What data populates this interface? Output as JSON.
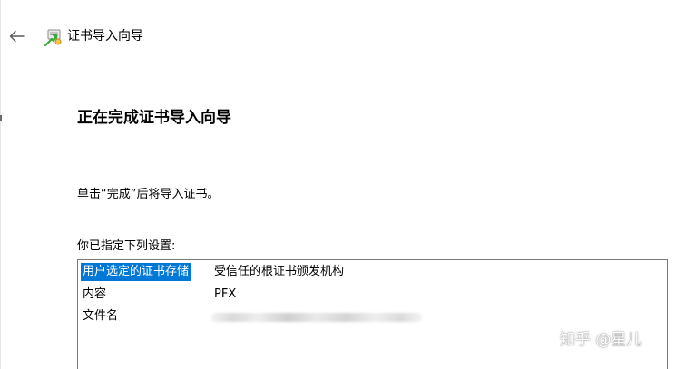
{
  "window": {
    "title": "证书导入向导",
    "back_icon": "arrow-left-icon",
    "wizard_icon": "certificate-import-icon"
  },
  "page": {
    "heading": "正在完成证书导入向导",
    "instruction": "单击“完成”后将导入证书。",
    "settings_label": "你已指定下列设置:"
  },
  "settings": {
    "rows": [
      {
        "key": "用户选定的证书存储",
        "value": "受信任的根证书颁发机构",
        "selected": true
      },
      {
        "key": "内容",
        "value": "PFX",
        "selected": false
      },
      {
        "key": "文件名",
        "value": "",
        "redacted": true,
        "selected": false
      }
    ]
  },
  "colors": {
    "selection": "#0078d7",
    "border": "#7a7a7a"
  },
  "watermark": {
    "text": "知乎 @星儿"
  }
}
